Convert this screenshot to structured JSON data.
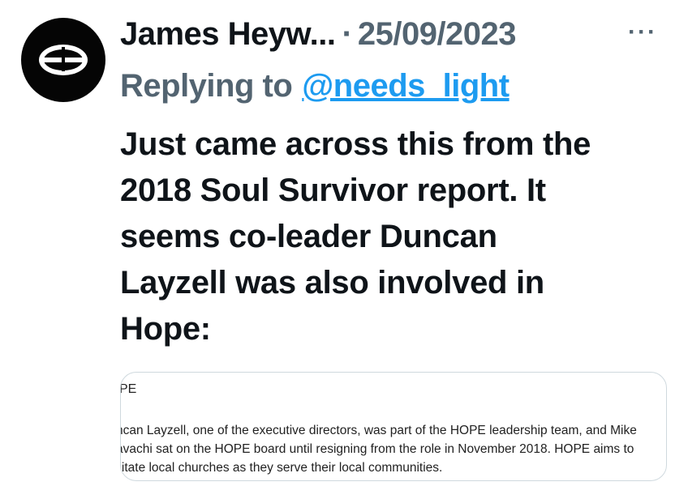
{
  "author": {
    "display_name": "James Heyw...",
    "separator": "·",
    "date": "25/09/2023",
    "avatar_icon": "halved-oval-logo-icon"
  },
  "more_button": {
    "label": "···",
    "icon": "more-options-icon"
  },
  "reply_context": {
    "prefix": "Replying to",
    "handle": "@needs_light"
  },
  "tweet": {
    "lines": [
      "Just came across this from the",
      "2018 Soul Survivor report. It",
      "seems co-leader Duncan",
      "Layzell was also involved in",
      "Hope:"
    ]
  },
  "media": {
    "heading": "PE",
    "lines": [
      "ncan Layzell, one of the executive directors, was part of the HOPE leadership team, and Mike",
      "avachi sat on the HOPE board until resigning from the role in November 2018. HOPE aims to",
      "ilitate local churches as they serve their local communities."
    ]
  },
  "colors": {
    "text_primary": "#0f1419",
    "text_secondary": "#536471",
    "link": "#1d9bf0",
    "border": "#cfd9de"
  }
}
